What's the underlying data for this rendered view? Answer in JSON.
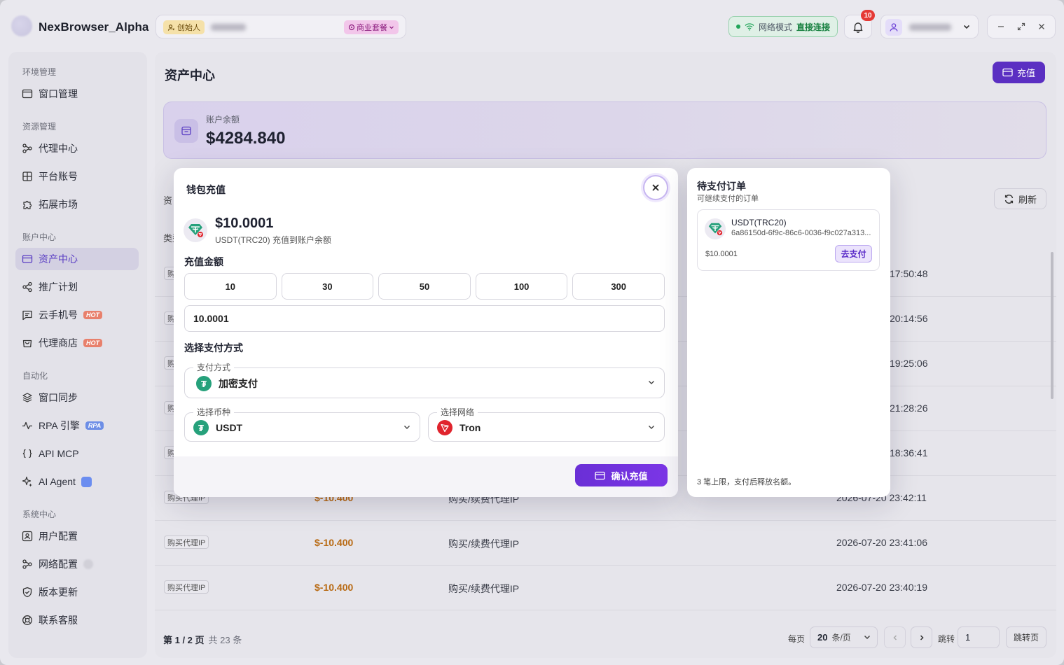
{
  "titlebar": {
    "app_name": "NexBrowser_Alpha",
    "founder_badge": "创始人",
    "plan_badge": "商业套餐",
    "network_label": "网络模式",
    "network_value": "直接连接",
    "notification_count": "10"
  },
  "sidebar": {
    "sections": [
      {
        "label": "环境管理",
        "items": [
          {
            "label": "窗口管理",
            "icon": "window-icon"
          }
        ]
      },
      {
        "label": "资源管理",
        "items": [
          {
            "label": "代理中心",
            "icon": "proxy-icon"
          },
          {
            "label": "平台账号",
            "icon": "grid-icon"
          },
          {
            "label": "拓展市场",
            "icon": "puzzle-icon"
          }
        ]
      },
      {
        "label": "账户中心",
        "items": [
          {
            "label": "资产中心",
            "icon": "card-icon",
            "active": true
          },
          {
            "label": "推广计划",
            "icon": "share-icon"
          },
          {
            "label": "云手机号",
            "icon": "message-icon",
            "tag": "HOT"
          },
          {
            "label": "代理商店",
            "icon": "shop-icon",
            "tag": "HOT"
          }
        ]
      },
      {
        "label": "自动化",
        "items": [
          {
            "label": "窗口同步",
            "icon": "layers-icon"
          },
          {
            "label": "RPA 引擎",
            "icon": "activity-icon",
            "tag": "RPA"
          },
          {
            "label": "API MCP",
            "icon": "braces-icon"
          },
          {
            "label": "AI Agent",
            "icon": "sparkle-icon"
          }
        ]
      },
      {
        "label": "系统中心",
        "items": [
          {
            "label": "用户配置",
            "icon": "user-config-icon"
          },
          {
            "label": "网络配置",
            "icon": "network-icon"
          },
          {
            "label": "版本更新",
            "icon": "shield-icon"
          },
          {
            "label": "联系客服",
            "icon": "support-icon"
          }
        ]
      }
    ]
  },
  "main": {
    "title": "资产中心",
    "recharge_button": "充值",
    "balance_label": "账户余额",
    "balance_value": "$4284.840",
    "refresh_button": "刷新",
    "table_fragments": {
      "left_heading": "资",
      "type_header": "类型"
    },
    "rows": [
      {
        "type": "购",
        "amount": "",
        "desc": "",
        "time": "17:50:48"
      },
      {
        "type": "购",
        "amount": "",
        "desc": "",
        "time": "20:14:56"
      },
      {
        "type": "购",
        "amount": "",
        "desc": "",
        "time": "19:25:06"
      },
      {
        "type": "购",
        "amount": "",
        "desc": "",
        "time": "21:28:26"
      },
      {
        "type": "购",
        "amount": "",
        "desc": "",
        "time": "18:36:41"
      },
      {
        "type": "购买代理IP",
        "amount": "$-10.400",
        "desc": "购买/续费代理IP",
        "time": "2026-07-20 23:42:11"
      },
      {
        "type": "购买代理IP",
        "amount": "$-10.400",
        "desc": "购买/续费代理IP",
        "time": "2026-07-20 23:41:06"
      },
      {
        "type": "购买代理IP",
        "amount": "$-10.400",
        "desc": "购买/续费代理IP",
        "time": "2026-07-20 23:40:19"
      }
    ],
    "pager": {
      "page_info": "第 1 / 2 页",
      "total": "共 23 条",
      "per_page_label": "每页",
      "page_size": "20",
      "page_size_unit": "条/页",
      "jump_label": "跳转",
      "jump_value": "1",
      "jump_button": "跳转页"
    }
  },
  "dialog": {
    "title": "钱包充值",
    "amount": "$10.0001",
    "subtitle": "USDT(TRC20) 充值到账户余额",
    "amount_section": "充值金额",
    "presets": [
      "10",
      "30",
      "50",
      "100",
      "300"
    ],
    "amount_input": "10.0001",
    "payment_section": "选择支付方式",
    "method_label": "支付方式",
    "method_value": "加密支付",
    "coin_label": "选择币种",
    "coin_value": "USDT",
    "network_label": "选择网络",
    "network_value": "Tron",
    "confirm_button": "确认充值"
  },
  "pending": {
    "title": "待支付订单",
    "subtitle": "可继续支付的订单",
    "order": {
      "name": "USDT(TRC20)",
      "id": "6a86150d-6f9c-86c6-0036-f9c027a313...",
      "amount": "$10.0001",
      "pay_button": "去支付"
    },
    "note": "3 笔上限，支付后释放名额。"
  }
}
